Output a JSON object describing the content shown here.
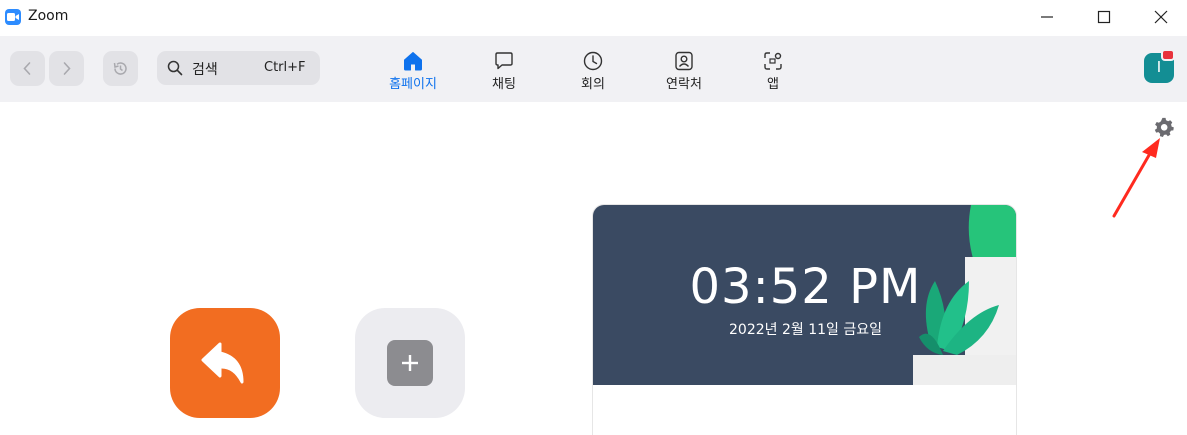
{
  "window": {
    "title": "Zoom"
  },
  "toolbar": {
    "search_label": "검색",
    "search_shortcut": "Ctrl+F",
    "tabs": [
      {
        "label": "홈페이지",
        "icon": "home-icon",
        "active": true
      },
      {
        "label": "채팅",
        "icon": "chat-icon",
        "active": false
      },
      {
        "label": "회의",
        "icon": "clock-icon",
        "active": false
      },
      {
        "label": "연락처",
        "icon": "contacts-icon",
        "active": false
      },
      {
        "label": "앱",
        "icon": "apps-icon",
        "active": false
      }
    ],
    "avatar_initial": "I"
  },
  "home": {
    "clock_time": "03:52 PM",
    "clock_date": "2022년 2월 11일 금요일"
  },
  "colors": {
    "accent": "#0e72ed",
    "join_button": "#f26d21",
    "card_banner": "#3a4a62",
    "avatar": "#138e94",
    "notification_badge": "#e8323c",
    "annotation_arrow": "#ff2a1f"
  }
}
